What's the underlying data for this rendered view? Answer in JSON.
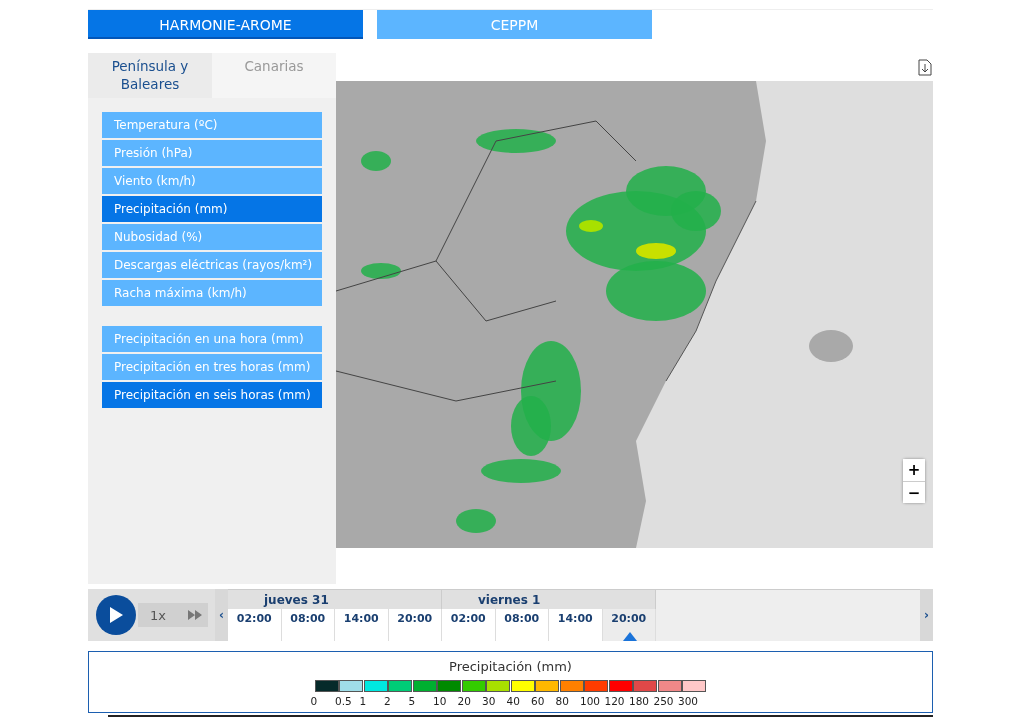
{
  "model_tabs": [
    {
      "label": "HARMONIE-AROME",
      "selected": true
    },
    {
      "label": "CEPPM",
      "selected": false
    }
  ],
  "region_tabs": [
    {
      "label": "Península y Baleares",
      "selected": true
    },
    {
      "label": "Canarias",
      "selected": false
    }
  ],
  "variables": [
    {
      "label": "Temperatura (ºC)",
      "selected": false
    },
    {
      "label": "Presión (hPa)",
      "selected": false
    },
    {
      "label": "Viento (km/h)",
      "selected": false
    },
    {
      "label": "Precipitación (mm)",
      "selected": true
    },
    {
      "label": "Nubosidad (%)",
      "selected": false
    },
    {
      "label": "Descargas eléctricas (rayos/km²)",
      "selected": false
    },
    {
      "label": "Racha máxima (km/h)",
      "selected": false
    }
  ],
  "accumulations": [
    {
      "label": "Precipitación en una hora (mm)",
      "selected": false
    },
    {
      "label": "Precipitación en tres horas (mm)",
      "selected": false
    },
    {
      "label": "Precipitación en seis horas (mm)",
      "selected": true
    }
  ],
  "map": {
    "zoom_in": "+",
    "zoom_out": "−"
  },
  "player": {
    "speed": "1x",
    "prev": "‹",
    "next": "›"
  },
  "timeline": [
    {
      "day": "jueves 31",
      "times": [
        {
          "label": "02:00",
          "selected": false
        },
        {
          "label": "08:00",
          "selected": false
        },
        {
          "label": "14:00",
          "selected": false
        },
        {
          "label": "20:00",
          "selected": false
        }
      ]
    },
    {
      "day": "viernes 1",
      "times": [
        {
          "label": "02:00",
          "selected": false
        },
        {
          "label": "08:00",
          "selected": false
        },
        {
          "label": "14:00",
          "selected": false
        },
        {
          "label": "20:00",
          "selected": true
        }
      ]
    }
  ],
  "legend": {
    "title": "Precipitación (mm)",
    "steps": [
      {
        "label": "0",
        "color": "#062a2a"
      },
      {
        "label": "0.5",
        "color": "#9fdde8"
      },
      {
        "label": "1",
        "color": "#00e8e0"
      },
      {
        "label": "2",
        "color": "#00cc77"
      },
      {
        "label": "5",
        "color": "#00b030"
      },
      {
        "label": "10",
        "color": "#008a00"
      },
      {
        "label": "20",
        "color": "#33cc00"
      },
      {
        "label": "30",
        "color": "#a8e000"
      },
      {
        "label": "40",
        "color": "#ffff00"
      },
      {
        "label": "60",
        "color": "#ffb800"
      },
      {
        "label": "80",
        "color": "#ff8000"
      },
      {
        "label": "100",
        "color": "#ff3c00"
      },
      {
        "label": "120",
        "color": "#ff0000"
      },
      {
        "label": "180",
        "color": "#e04848"
      },
      {
        "label": "250",
        "color": "#f08888"
      },
      {
        "label": "300",
        "color": "#ffc8c8"
      }
    ]
  }
}
